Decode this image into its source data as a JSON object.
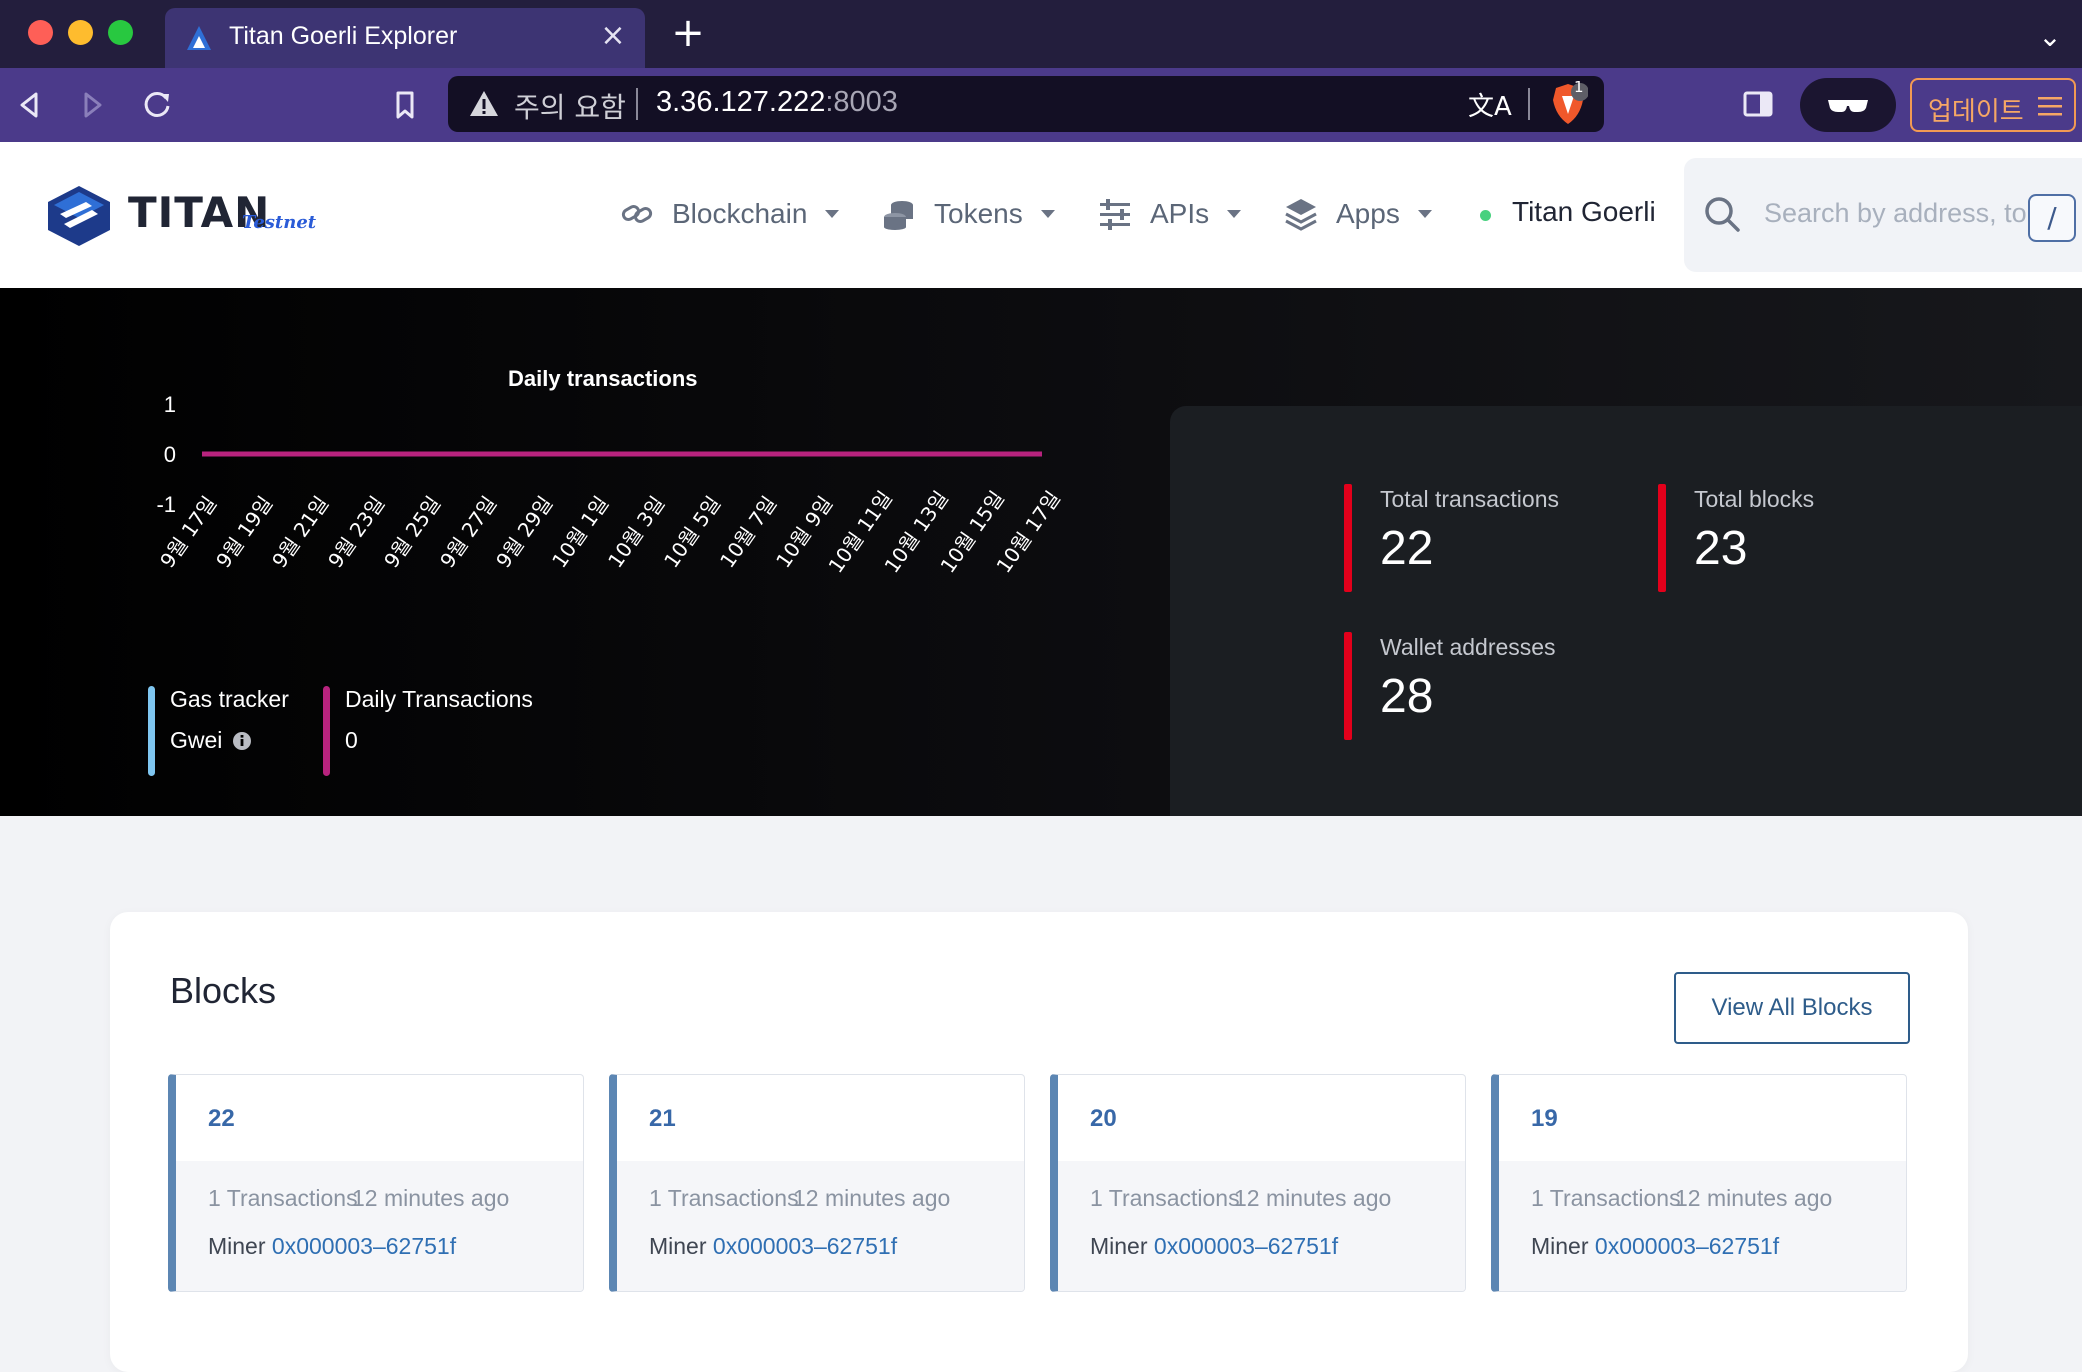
{
  "browser": {
    "tab_title": "Titan Goerli Explorer",
    "security_warning": "주의 요함",
    "url_host": "3.36.127.222",
    "url_port": ":8003",
    "shields_count": "1",
    "update_label": "업데이트",
    "translate_glyph": "文A"
  },
  "header": {
    "brand_name": "TITAN",
    "brand_network": "Testnet",
    "nav": [
      {
        "label": "Blockchain"
      },
      {
        "label": "Tokens"
      },
      {
        "label": "APIs"
      },
      {
        "label": "Apps"
      }
    ],
    "network_name": "Titan Goerli",
    "search_placeholder": "Search by address, token symbol, name, transaction hash, or block number",
    "search_shortcut": "/"
  },
  "dashboard": {
    "chart_title": "Daily transactions",
    "gas_tracker_label": "Gas tracker",
    "gas_tracker_value": "Gwei",
    "daily_tx_label": "Daily Transactions",
    "daily_tx_value": "0",
    "stats": {
      "total_transactions_label": "Total transactions",
      "total_transactions": "22",
      "total_blocks_label": "Total blocks",
      "total_blocks": "23",
      "wallet_addresses_label": "Wallet addresses",
      "wallet_addresses": "28"
    }
  },
  "chart_data": {
    "type": "line",
    "title": "Daily transactions",
    "x": [
      "9월 17일",
      "9월 19일",
      "9월 21일",
      "9월 23일",
      "9월 25일",
      "9월 27일",
      "9월 29일",
      "10월 1일",
      "10월 3일",
      "10월 5일",
      "10월 7일",
      "10월 9일",
      "10월 11일",
      "10월 13일",
      "10월 15일",
      "10월 17일"
    ],
    "series": [
      {
        "values": [
          0,
          0,
          0,
          0,
          0,
          0,
          0,
          0,
          0,
          0,
          0,
          0,
          0,
          0,
          0,
          0
        ],
        "color": "#b8237e"
      }
    ],
    "yticks": [
      "1",
      "0",
      "-1"
    ],
    "ylim": [
      -1,
      1
    ],
    "grid": false,
    "xlabel": "",
    "ylabel": ""
  },
  "blocks": {
    "title": "Blocks",
    "view_all_label": "View All Blocks",
    "items": [
      {
        "number": "22",
        "txs": "1 Transactions",
        "age": "12 minutes ago",
        "miner_label": "Miner",
        "miner": "0x000003–62751f"
      },
      {
        "number": "21",
        "txs": "1 Transactions",
        "age": "12 minutes ago",
        "miner_label": "Miner",
        "miner": "0x000003–62751f"
      },
      {
        "number": "20",
        "txs": "1 Transactions",
        "age": "12 minutes ago",
        "miner_label": "Miner",
        "miner": "0x000003–62751f"
      },
      {
        "number": "19",
        "txs": "1 Transactions",
        "age": "12 minutes ago",
        "miner_label": "Miner",
        "miner": "0x000003–62751f"
      }
    ]
  },
  "colors": {
    "accent_red": "#e3001b",
    "chart_line": "#b8237e",
    "gas_bar": "#7fc6f0",
    "daily_bar": "#b8237e",
    "link": "#2f6fb3"
  },
  "icons": [
    "back-icon",
    "forward-icon",
    "reload-icon",
    "bookmark-icon",
    "warning-icon",
    "translate-icon",
    "brave-shields-icon",
    "sidebar-toggle-icon",
    "private-glasses-icon",
    "menu-icon",
    "link-icon",
    "coins-icon",
    "sliders-icon",
    "layers-icon",
    "search-icon",
    "info-icon"
  ]
}
